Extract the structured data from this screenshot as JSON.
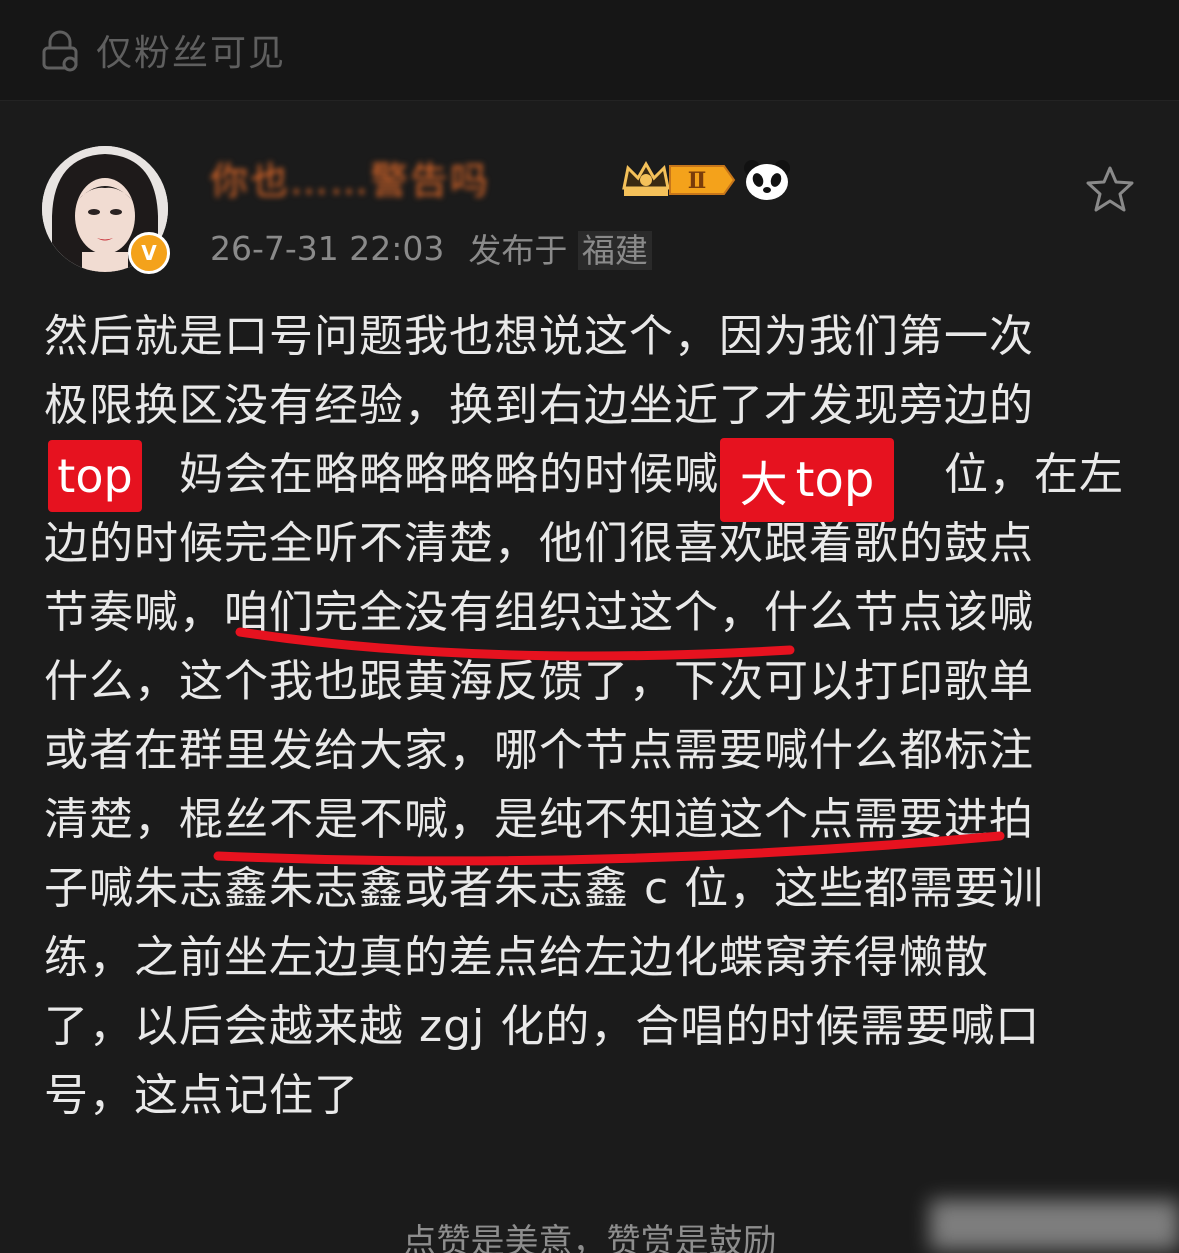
{
  "visibility": {
    "label": "仅粉丝可见",
    "icon": "lock-icon"
  },
  "post": {
    "username": "你也……警告吗",
    "timestamp": "26-7-31 22:03",
    "location_prefix": "发布于",
    "location": "福建",
    "badge_level": "Ⅱ",
    "lines": [
      "然后就是口号问题我也想说这个，因为我们第一次",
      "极限换区没有经验，换到右边坐近了才发现旁边的",
      "　　　妈会在略略略略略的时候喊　　　　　位，在左",
      "边的时候完全听不清楚，他们很喜欢跟着歌的鼓点",
      "节奏喊，咱们完全没有组织过这个，什么节点该喊",
      "什么，这个我也跟黄海反馈了，下次可以打印歌单",
      "或者在群里发给大家，哪个节点需要喊什么都标注",
      "清楚，棍丝不是不喊，是纯不知道这个点需要进拍",
      "子喊朱志鑫朱志鑫或者朱志鑫 c 位，这些都需要训",
      "练，之前坐左边真的差点给左边化蝶窝养得懒散",
      "了，以后会越来越 zgj 化的，合唱的时候需要喊口",
      "号，这点记住了"
    ]
  },
  "overlays": {
    "tag1": "top",
    "tag2_prefix": "大",
    "tag2_word": "top"
  },
  "footer": {
    "text": "点赞是美意，赞赏是鼓励"
  },
  "colors": {
    "background": "#1b1b1b",
    "accent_red": "#e6121f",
    "username_orange": "#e06a2a",
    "badge_gold": "#f4a21b"
  }
}
